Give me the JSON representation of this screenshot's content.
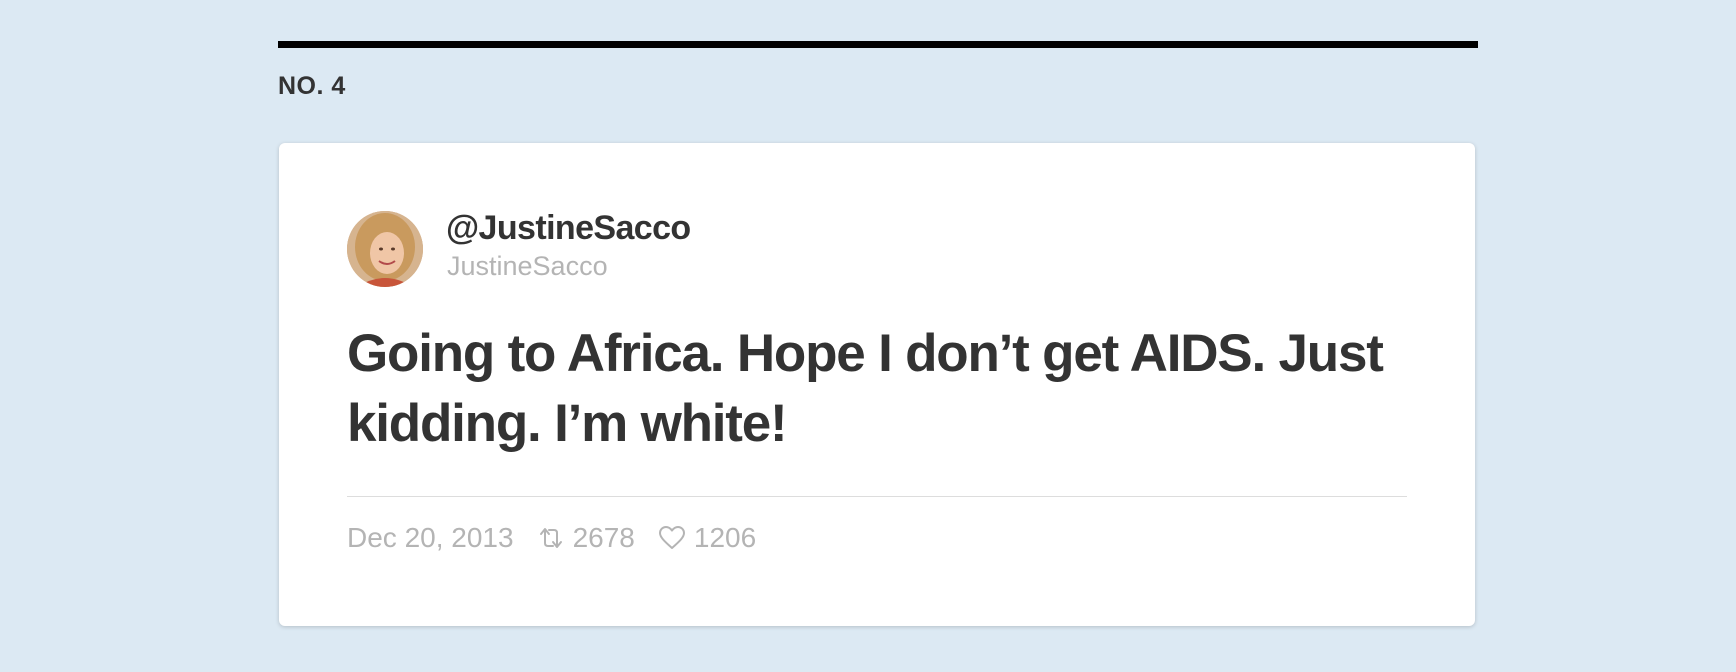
{
  "section": {
    "number_label": "NO. 4"
  },
  "tweet": {
    "handle": "@JustineSacco",
    "display_name": "JustineSacco",
    "text": "Going to Africa. Hope I don’t get AIDS. Just kidding. I’m white!",
    "date": "Dec 20, 2013",
    "retweet_count": "2678",
    "like_count": "1206",
    "avatar_icon": "profile-photo",
    "retweet_icon": "retweet-icon",
    "like_icon": "heart-icon"
  },
  "colors": {
    "background": "#dce9f3",
    "card": "#ffffff",
    "text": "#333333",
    "muted": "#b4b4b4",
    "rule": "#000000"
  }
}
